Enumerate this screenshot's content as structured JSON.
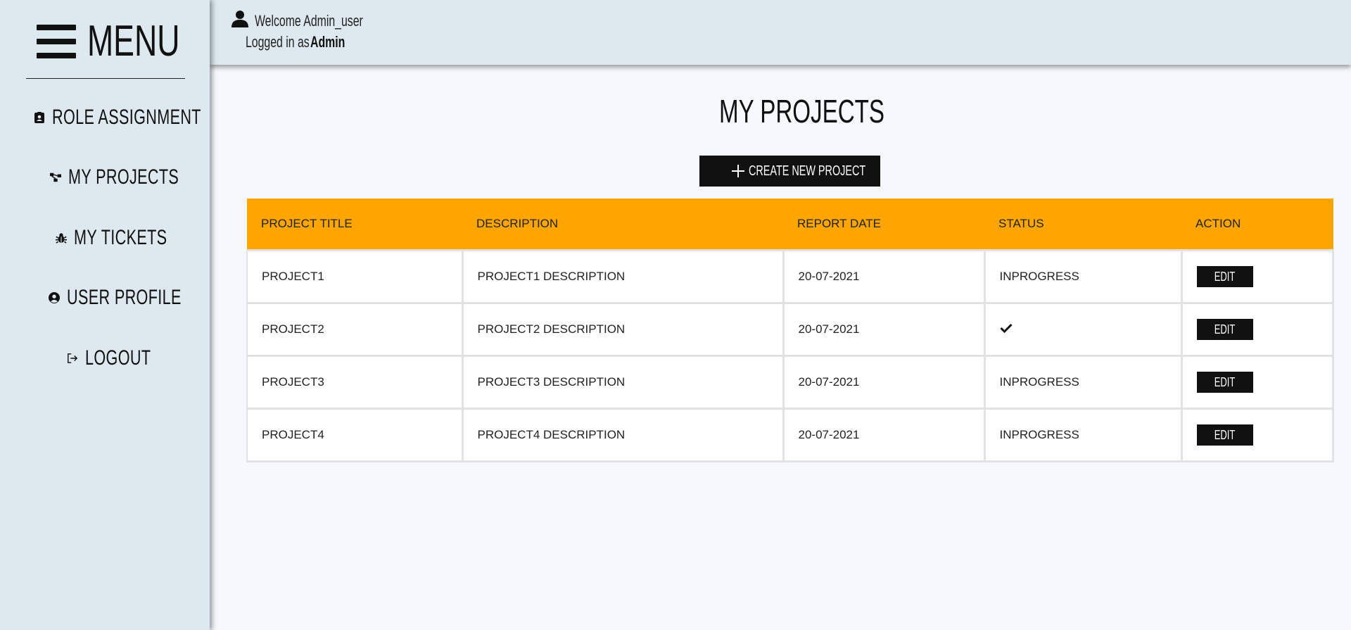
{
  "sidebar": {
    "menu_title": "MENU",
    "items": [
      {
        "label": "ROLE ASSIGNMENT",
        "icon": "badge-icon"
      },
      {
        "label": "MY PROJECTS",
        "icon": "project-diagram-icon"
      },
      {
        "label": "MY TICKETS",
        "icon": "bug-icon"
      },
      {
        "label": "USER PROFILE",
        "icon": "user-circle-icon"
      },
      {
        "label": "LOGOUT",
        "icon": "sign-out-icon"
      }
    ]
  },
  "header": {
    "welcome": "Welcome Admin_user",
    "logged_in_label": "Logged in as",
    "role": "Admin"
  },
  "main": {
    "title": "MY PROJECTS",
    "create_button": "CREATE NEW PROJECT",
    "table": {
      "headers": [
        "PROJECT TITLE",
        "DESCRIPTION",
        "REPORT DATE",
        "STATUS",
        "ACTION"
      ],
      "rows": [
        {
          "title": "PROJECT1",
          "description": "PROJECT1 DESCRIPTION",
          "date": "20-07-2021",
          "status": "INPROGRESS",
          "action": "EDIT"
        },
        {
          "title": "PROJECT2",
          "description": "PROJECT2 DESCRIPTION",
          "date": "20-07-2021",
          "status": "",
          "status_icon": "check-icon",
          "action": "EDIT"
        },
        {
          "title": "PROJECT3",
          "description": "PROJECT3 DESCRIPTION",
          "date": "20-07-2021",
          "status": "INPROGRESS",
          "action": "EDIT"
        },
        {
          "title": "PROJECT4",
          "description": "PROJECT4 DESCRIPTION",
          "date": "20-07-2021",
          "status": "INPROGRESS",
          "action": "EDIT"
        }
      ]
    }
  },
  "colors": {
    "panel_bg": "#dde9ee",
    "page_bg": "#f5f8fc",
    "table_header": "#ffa500",
    "button_bg": "#111111"
  }
}
